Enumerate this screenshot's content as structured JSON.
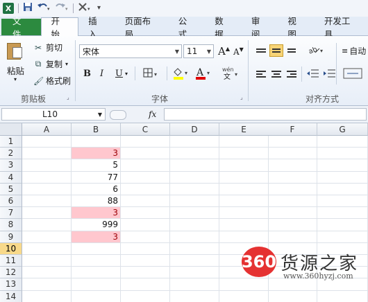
{
  "quick_access": {
    "app_icon": "X",
    "save_icon": "save-icon",
    "undo_icon": "undo-icon",
    "redo_icon": "redo-icon"
  },
  "tabs": [
    {
      "label": "文件"
    },
    {
      "label": "开始"
    },
    {
      "label": "插入"
    },
    {
      "label": "页面布局"
    },
    {
      "label": "公式"
    },
    {
      "label": "数据"
    },
    {
      "label": "审阅"
    },
    {
      "label": "视图"
    },
    {
      "label": "开发工具"
    }
  ],
  "clipboard": {
    "paste_label": "粘贴",
    "cut_label": "剪切",
    "copy_label": "复制",
    "format_painter_label": "格式刷",
    "group_label": "剪贴板"
  },
  "font": {
    "font_name": "宋体",
    "font_size": "11",
    "bold": "B",
    "italic": "I",
    "underline": "U",
    "group_label": "字体",
    "grow_label": "A",
    "shrink_label": "A"
  },
  "alignment": {
    "group_label": "对齐方式",
    "wrap_label": "自动"
  },
  "formula_bar": {
    "name_box": "L10",
    "fx_label": "fx",
    "formula": ""
  },
  "sheet": {
    "columns": [
      "A",
      "B",
      "C",
      "D",
      "E",
      "F",
      "G"
    ],
    "rows": [
      "1",
      "2",
      "3",
      "4",
      "5",
      "6",
      "7",
      "8",
      "9",
      "10",
      "11",
      "12",
      "13",
      "14"
    ],
    "selected_row": "10",
    "column_b_values": [
      "",
      "3",
      "5",
      "77",
      "6",
      "88",
      "3",
      "999",
      "3",
      "",
      "",
      "",
      "",
      ""
    ],
    "highlighted_rows": [
      2,
      7,
      9
    ],
    "highlight_fill": "#ffc7ce",
    "highlight_text": "#9c0006"
  },
  "watermark": {
    "badge": "360",
    "name": "货源之家",
    "url": "www.360hyzj.com"
  },
  "colors": {
    "file_tab": "#2c8a3f",
    "selected_row_header": "#f8d98a"
  }
}
